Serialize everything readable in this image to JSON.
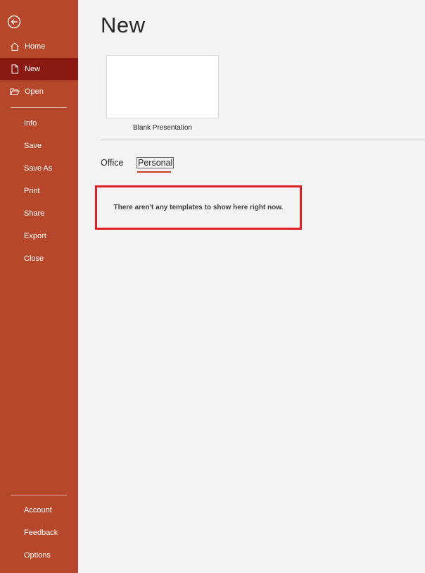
{
  "sidebar": {
    "back_icon": "back-arrow-icon",
    "top_items": [
      {
        "label": "Home",
        "icon": "home-icon"
      },
      {
        "label": "New",
        "icon": "new-document-icon",
        "active": true
      },
      {
        "label": "Open",
        "icon": "open-folder-icon"
      }
    ],
    "middle_items": [
      "Info",
      "Save",
      "Save As",
      "Print",
      "Share",
      "Export",
      "Close"
    ],
    "bottom_items": [
      "Account",
      "Feedback",
      "Options"
    ]
  },
  "main": {
    "title": "New",
    "blank_template_label": "Blank Presentation",
    "tabs": [
      {
        "label": "Office",
        "selected": false
      },
      {
        "label": "Personal",
        "selected": true
      }
    ],
    "empty_message": "There aren't any templates to show here right now."
  },
  "colors": {
    "sidebar": "#b7472a",
    "sidebar_active": "#8a1a11",
    "background": "#f3f3f3",
    "tab_underline": "#c43e1c",
    "highlight_border": "#e01f26"
  }
}
